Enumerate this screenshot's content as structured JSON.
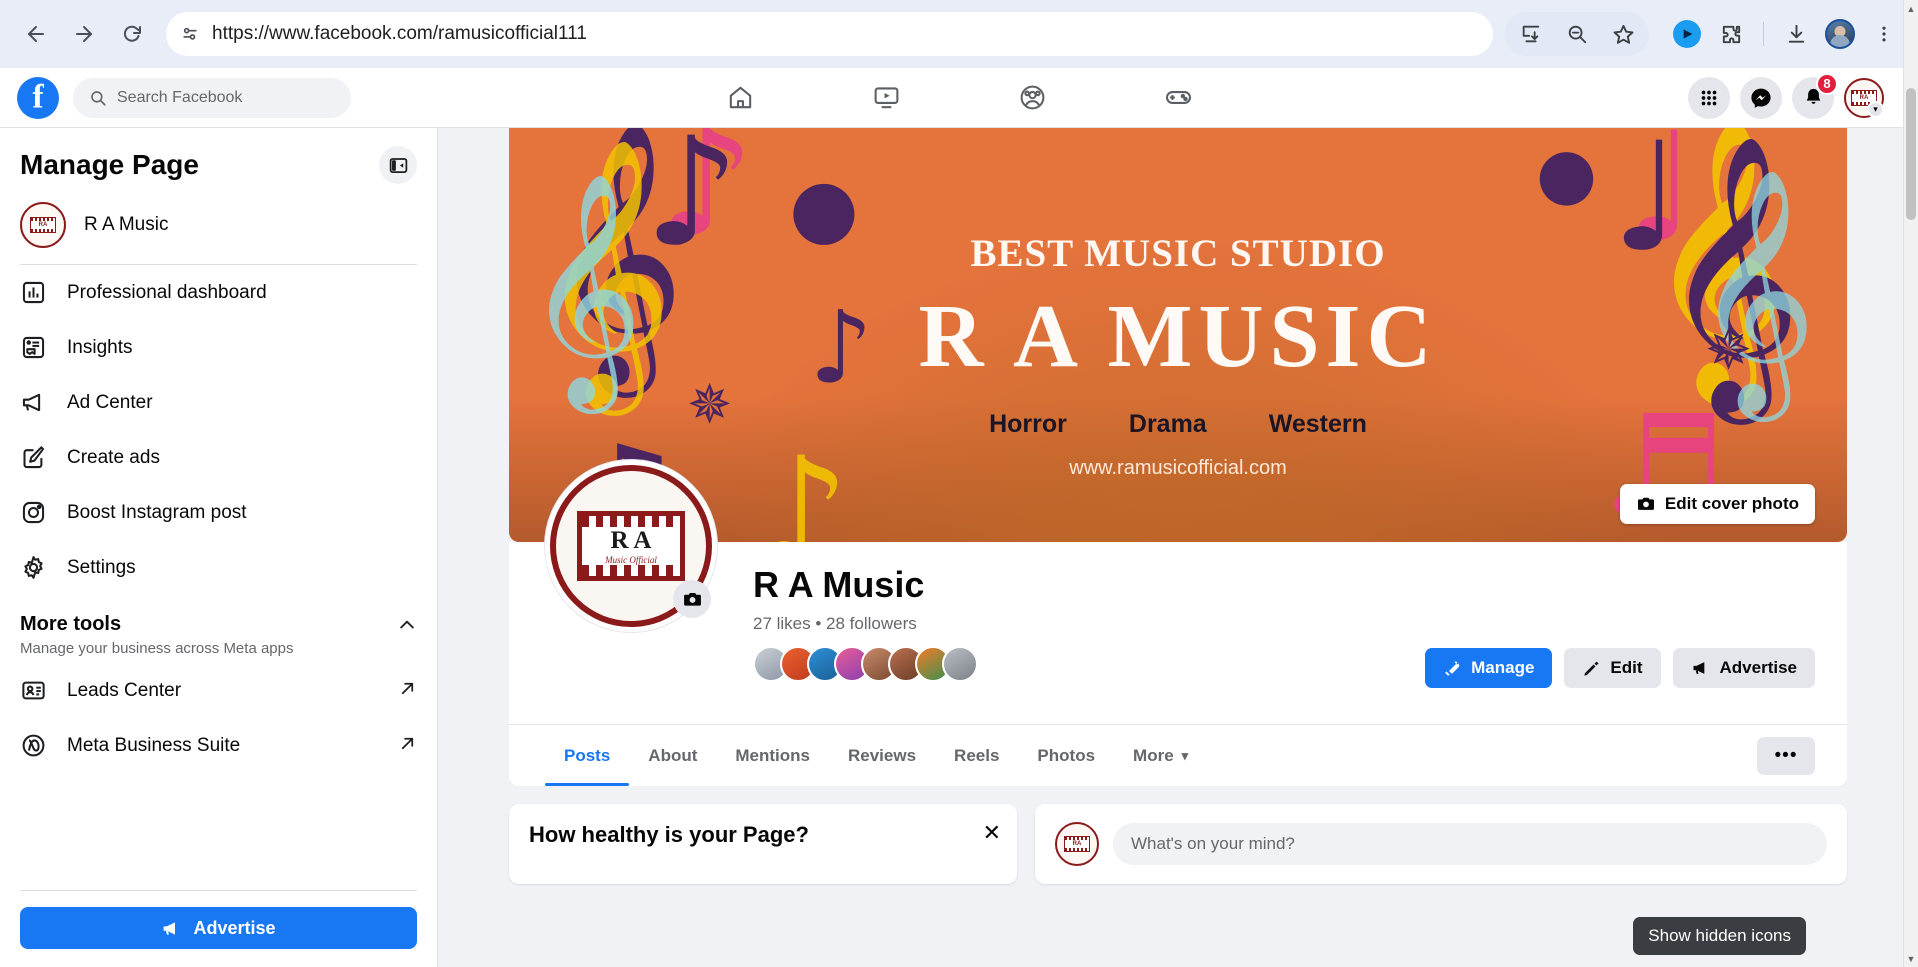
{
  "browser": {
    "url": "https://www.facebook.com/ramusicofficial111",
    "back_label": "Back",
    "forward_label": "Forward",
    "reload_label": "Reload",
    "site_info_label": "View site information",
    "install_label": "Install",
    "zoom_out_label": "Zoom out",
    "bookmark_label": "Bookmark this tab",
    "extension_label": "Extension",
    "extensions_label": "Extensions",
    "downloads_label": "Downloads",
    "profile_label": "Profile",
    "menu_label": "Customize and control Google Chrome"
  },
  "fb_header": {
    "logo_letter": "f",
    "search_placeholder": "Search Facebook",
    "nav": [
      {
        "name": "home",
        "label": "Home"
      },
      {
        "name": "video",
        "label": "Video"
      },
      {
        "name": "groups",
        "label": "Groups"
      },
      {
        "name": "gaming",
        "label": "Gaming"
      }
    ],
    "menu_label": "Menu",
    "messenger_label": "Messenger",
    "notifications_label": "Notifications",
    "notifications_badge": "8",
    "account_label": "Account",
    "account_chevron": "▾"
  },
  "sidebar": {
    "title": "Manage Page",
    "collapse_label": "Collapse sidebar",
    "page_name": "R A Music",
    "avatar_text": "RA",
    "items": [
      {
        "label": "Professional dashboard",
        "icon": "dashboard-icon",
        "external": false
      },
      {
        "label": "Insights",
        "icon": "insights-icon",
        "external": false
      },
      {
        "label": "Ad Center",
        "icon": "ad-center-icon",
        "external": false
      },
      {
        "label": "Create ads",
        "icon": "create-ads-icon",
        "external": false
      },
      {
        "label": "Boost Instagram post",
        "icon": "instagram-icon",
        "external": false
      },
      {
        "label": "Settings",
        "icon": "gear-icon",
        "external": false
      }
    ],
    "more_tools_title": "More tools",
    "more_tools_sub": "Manage your business across Meta apps",
    "more_tools_chevron": "⌃",
    "tools": [
      {
        "label": "Leads Center",
        "icon": "leads-center-icon",
        "external": true
      },
      {
        "label": "Meta Business Suite",
        "icon": "meta-icon",
        "external": true
      }
    ],
    "advertise_label": "Advertise"
  },
  "cover": {
    "headline": "BEST MUSIC STUDIO",
    "title": "R A MUSIC",
    "genres": [
      "Horror",
      "Drama",
      "Western"
    ],
    "website": "www.ramusicofficial.com",
    "edit_label": "Edit cover photo"
  },
  "profile": {
    "name": "R A Music",
    "stats": "27 likes • 28 followers",
    "avatar_initials": "R A",
    "avatar_sub": "Music Official",
    "camera_label": "Edit profile picture",
    "followers": [
      {
        "c1": "#c9cfd6",
        "c2": "#8d98a5"
      },
      {
        "c1": "#e8622f",
        "c2": "#c23b1e"
      },
      {
        "c1": "#2e8fd6",
        "c2": "#1a5f96"
      },
      {
        "c1": "#e95d97",
        "c2": "#8a3fb0"
      },
      {
        "c1": "#c98b6a",
        "c2": "#7b4a33"
      },
      {
        "c1": "#b9714f",
        "c2": "#6d3c26"
      },
      {
        "c1": "#f07d2a",
        "c2": "#3f8f4e"
      },
      {
        "c1": "#b9bec4",
        "c2": "#7c8288"
      }
    ],
    "actions": [
      {
        "label": "Manage",
        "icon": "tools-icon",
        "style": "primary"
      },
      {
        "label": "Edit",
        "icon": "pencil-icon",
        "style": "secondary"
      },
      {
        "label": "Advertise",
        "icon": "megaphone-icon",
        "style": "secondary"
      }
    ]
  },
  "tabs": {
    "items": [
      {
        "label": "Posts",
        "active": true
      },
      {
        "label": "About",
        "active": false
      },
      {
        "label": "Mentions",
        "active": false
      },
      {
        "label": "Reviews",
        "active": false
      },
      {
        "label": "Reels",
        "active": false
      },
      {
        "label": "Photos",
        "active": false
      },
      {
        "label": "More",
        "active": false,
        "chevron": "▾"
      }
    ],
    "more_label": "•••"
  },
  "content": {
    "health_card_title": "How healthy is your Page?",
    "health_card_close": "✕",
    "composer_placeholder": "What's on your mind?"
  },
  "tooltip": {
    "text": "Show hidden icons"
  },
  "scrollbar": {
    "up": "▲",
    "down": "▼"
  }
}
